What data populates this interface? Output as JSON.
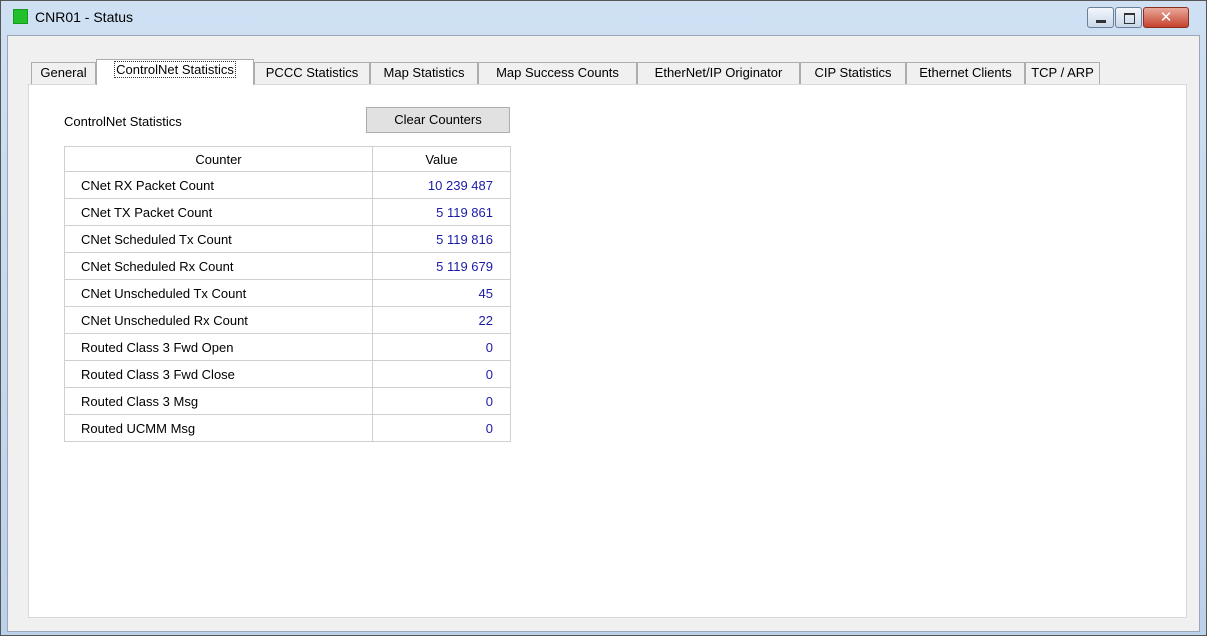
{
  "window": {
    "title": "CNR01 - Status",
    "close_glyph": "✕"
  },
  "tabs": [
    {
      "label": "General",
      "active": false
    },
    {
      "label": "ControlNet Statistics",
      "active": true
    },
    {
      "label": "PCCC Statistics",
      "active": false
    },
    {
      "label": "Map Statistics",
      "active": false
    },
    {
      "label": "Map Success Counts",
      "active": false
    },
    {
      "label": "EtherNet/IP Originator",
      "active": false
    },
    {
      "label": "CIP Statistics",
      "active": false
    },
    {
      "label": "Ethernet Clients",
      "active": false
    },
    {
      "label": "TCP / ARP",
      "active": false
    }
  ],
  "panel": {
    "section_label": "ControlNet Statistics",
    "clear_button": "Clear Counters"
  },
  "table": {
    "headers": {
      "counter": "Counter",
      "value": "Value"
    },
    "rows": [
      {
        "counter": "CNet RX Packet Count",
        "value": "10 239 487"
      },
      {
        "counter": "CNet TX Packet Count",
        "value": "5 119 861"
      },
      {
        "counter": "CNet Scheduled Tx Count",
        "value": "5 119 816"
      },
      {
        "counter": "CNet Scheduled Rx Count",
        "value": "5 119 679"
      },
      {
        "counter": "CNet Unscheduled Tx Count",
        "value": "45"
      },
      {
        "counter": "CNet Unscheduled Rx Count",
        "value": "22"
      },
      {
        "counter": "Routed Class 3 Fwd Open",
        "value": "0"
      },
      {
        "counter": "Routed Class 3 Fwd Close",
        "value": "0"
      },
      {
        "counter": "Routed Class 3 Msg",
        "value": "0"
      },
      {
        "counter": "Routed UCMM Msg",
        "value": "0"
      }
    ]
  },
  "colors": {
    "value_text": "#1b1ba8",
    "app_icon": "#22c02a",
    "close_button": "#c6432d"
  }
}
